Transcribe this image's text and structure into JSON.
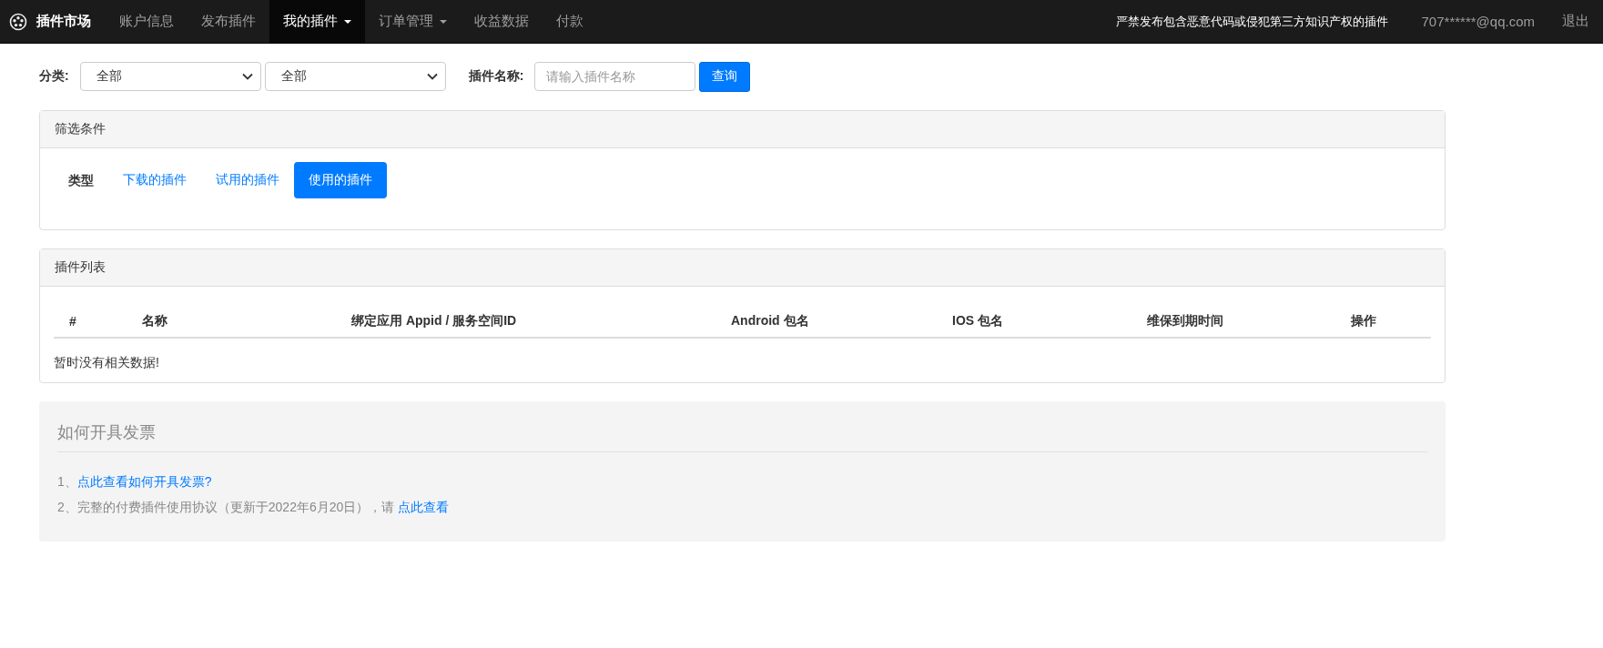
{
  "navbar": {
    "brand": "插件市场",
    "items": [
      {
        "label": "账户信息",
        "selected": false,
        "has_caret": false
      },
      {
        "label": "发布插件",
        "selected": false,
        "has_caret": false
      },
      {
        "label": "我的插件",
        "selected": true,
        "has_caret": true
      },
      {
        "label": "订单管理",
        "selected": false,
        "has_caret": true
      },
      {
        "label": "收益数据",
        "selected": false,
        "has_caret": false
      },
      {
        "label": "付款",
        "selected": false,
        "has_caret": false
      }
    ],
    "notice": "严禁发布包含恶意代码或侵犯第三方知识产权的插件",
    "user_email": "707******@qq.com",
    "logout": "退出"
  },
  "filter_bar": {
    "category_label": "分类:",
    "selects": [
      {
        "value": "全部"
      },
      {
        "value": "全部"
      }
    ],
    "name_label": "插件名称:",
    "name_input": {
      "placeholder": "请输入插件名称"
    },
    "search_button": "查询"
  },
  "filter_panel": {
    "title": "筛选条件",
    "type_label": "类型",
    "options": [
      {
        "label": "下载的插件",
        "selected": false
      },
      {
        "label": "试用的插件",
        "selected": false
      },
      {
        "label": "使用的插件",
        "selected": true
      }
    ]
  },
  "list_panel": {
    "title": "插件列表",
    "columns": [
      "#",
      "名称",
      "绑定应用 Appid / 服务空间ID",
      "Android 包名",
      "IOS 包名",
      "维保到期时间",
      "操作"
    ],
    "empty_message": "暂时没有相关数据!"
  },
  "invoice": {
    "title": "如何开具发票",
    "lines": [
      {
        "text": "1、",
        "link": "点此查看如何开具发票?"
      },
      {
        "text": "2、完整的付费插件使用协议（更新于2022年6月20日），请 ",
        "link": "点此查看"
      }
    ]
  }
}
